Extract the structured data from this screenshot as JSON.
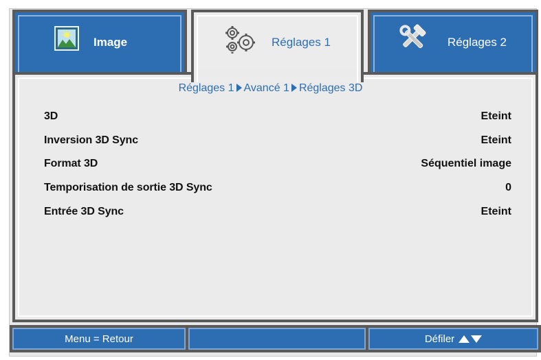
{
  "tabs": [
    {
      "label": "Image",
      "icon": "image-icon",
      "active": false
    },
    {
      "label": "Réglages 1",
      "icon": "gears-icon",
      "active": true
    },
    {
      "label": "Réglages 2",
      "icon": "tools-icon",
      "active": false
    }
  ],
  "breadcrumb": [
    "Réglages 1",
    "Avancé 1",
    "Réglages 3D"
  ],
  "settings": [
    {
      "label": "3D",
      "value": "Eteint"
    },
    {
      "label": "Inversion 3D Sync",
      "value": "Eteint"
    },
    {
      "label": "Format 3D",
      "value": "Séquentiel image"
    },
    {
      "label": "Temporisation de sortie 3D Sync",
      "value": "0"
    },
    {
      "label": "Entrée 3D Sync",
      "value": "Eteint"
    }
  ],
  "footer": {
    "back": "Menu = Retour",
    "middle": "",
    "scroll": "Défiler"
  },
  "colors": {
    "accent": "#2d6eb3",
    "border": "#5a5a5a",
    "panel": "#ebebeb"
  }
}
